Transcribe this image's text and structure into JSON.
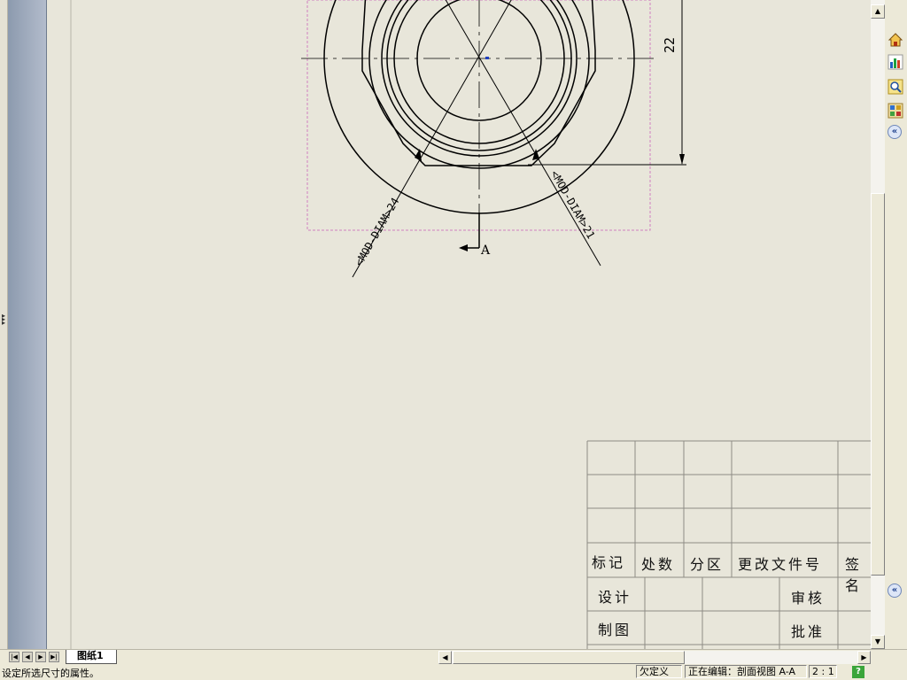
{
  "drawing": {
    "dim_vertical": "22",
    "dim_left": "<MOD-DIAM>24",
    "dim_right": "<MOD-DIAM>21",
    "section_label": "A"
  },
  "title_block": {
    "headers": [
      "标记",
      "处数",
      "分区",
      "更改文件号",
      "签名"
    ],
    "design": "设计",
    "review": "审核",
    "drafting": "制图",
    "approve": "批准"
  },
  "sheet_tab": "图纸1",
  "status": {
    "message": "设定所选尺寸的属性。",
    "state": "欠定义",
    "editing": "正在编辑：剖面视图 A-A",
    "scale": "2 : 1"
  },
  "icons": [
    "home-icon",
    "chart-icon",
    "search-icon",
    "palette-icon",
    "collapse-icon",
    "help-icon"
  ]
}
